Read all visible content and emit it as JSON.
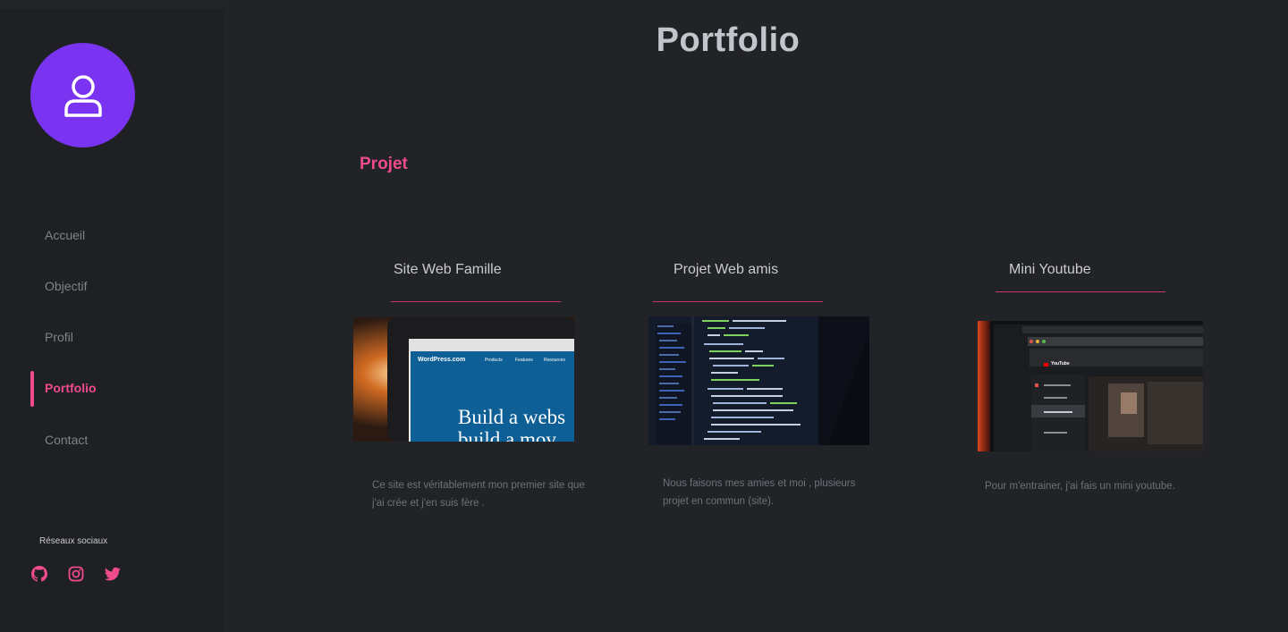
{
  "header": {
    "title": "Portfolio"
  },
  "nav": {
    "items": [
      {
        "label": "Accueil"
      },
      {
        "label": "Objectif"
      },
      {
        "label": "Profil"
      },
      {
        "label": "Portfolio",
        "active": true
      },
      {
        "label": "Contact"
      }
    ]
  },
  "social": {
    "title": "Réseaux sociaux",
    "icons": [
      "github-icon",
      "instagram-icon",
      "twitter-icon"
    ],
    "color": "#ef4b8c"
  },
  "section": {
    "title": "Projet"
  },
  "projects": [
    {
      "title": "Site Web Famille",
      "image_text": "Build a webs build a mov",
      "image_brand": "WordPress.com",
      "image_menu": [
        "Products",
        "Features",
        "Resources"
      ],
      "description": "Ce site est véritablement mon premier site que j'ai crée et j'en suis fère ."
    },
    {
      "title": "Projet Web amis",
      "description": "Nous faisons mes amies et moi , plusieurs projet en commun (site)."
    },
    {
      "title": "Mini Youtube",
      "image_brand": "YouTube",
      "description": "Pour m'entrainer, j'ai fais un mini youtube."
    }
  ],
  "colors": {
    "background": "#222327",
    "sidebar": "#1f2024",
    "accent": "#ef4b8c",
    "avatar": "#7a33f0"
  }
}
